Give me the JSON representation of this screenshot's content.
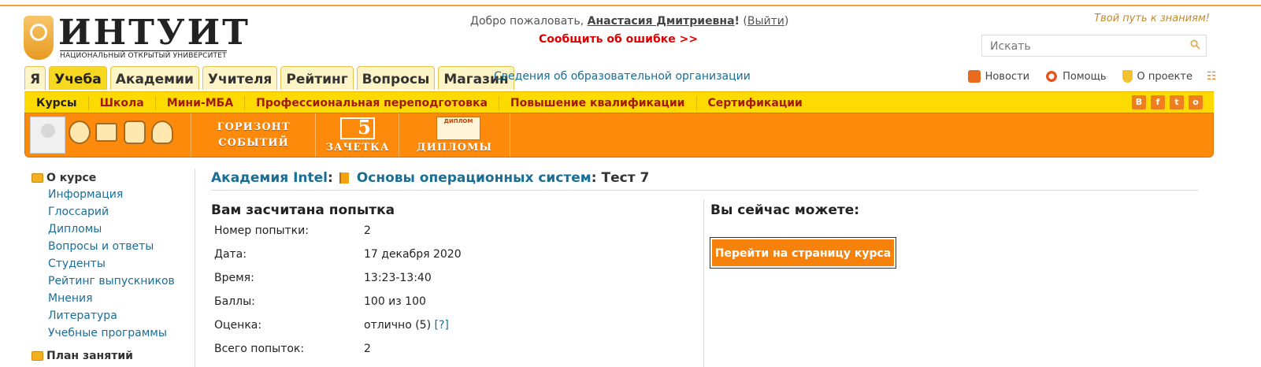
{
  "header": {
    "logo_text": "ИНТУИТ",
    "logo_sub": "НАЦИОНАЛЬНЫЙ ОТКРЫТЫЙ УНИВЕРСИТЕТ",
    "welcome_prefix": "Добро пожаловать,",
    "user_name": "Анастасия Дмитриевна",
    "user_suffix": "!",
    "exit_label": "Выйти",
    "report_error": "Сообщить об ошибке >>",
    "slogan": "Твой путь к знаниям!",
    "search_placeholder": "Искать"
  },
  "tabs": [
    "Я",
    "Учеба",
    "Академии",
    "Учителя",
    "Рейтинг",
    "Вопросы",
    "Магазин"
  ],
  "active_tab": "Учеба",
  "org_link": "Сведения об образовательной организации",
  "top_links": {
    "news": "Новости",
    "help": "Помощь",
    "about": "О проекте"
  },
  "submenu": [
    "Курсы",
    "Школа",
    "Мини-МБА",
    "Профессиональная переподготовка",
    "Повышение квалификации",
    "Сертификации"
  ],
  "social": [
    "В",
    "f",
    "t",
    "о"
  ],
  "orange_band": {
    "horizon_line1": "ГОРИЗОНТ",
    "horizon_line2": "СОБЫТИЙ",
    "zachetka": "ЗАЧЕТКА",
    "zachetka_num": "5",
    "diplomas": "ДИПЛОМЫ",
    "diploma_badge": "ДИПЛОМ"
  },
  "sidebar": {
    "section1": "О курсе",
    "items": [
      "Информация",
      "Глоссарий",
      "Дипломы",
      "Вопросы и ответы",
      "Студенты",
      "Рейтинг выпускников",
      "Мнения",
      "Литература",
      "Учебные программы"
    ],
    "section2": "План занятий"
  },
  "breadcrumb": {
    "academy": "Академия Intel",
    "course": "Основы операционных систем",
    "test": "Тест 7"
  },
  "result": {
    "title": "Вам засчитана попытка",
    "rows": [
      {
        "label": "Номер попытки:",
        "value": "2"
      },
      {
        "label": "Дата:",
        "value": "17 декабря 2020"
      },
      {
        "label": "Время:",
        "value": "13:23-13:40"
      },
      {
        "label": "Баллы:",
        "value": "100 из 100"
      },
      {
        "label": "Оценка:",
        "value": "отлично (5)",
        "hint": "[?]"
      },
      {
        "label": "Всего попыток:",
        "value": "2"
      }
    ]
  },
  "actions": {
    "title": "Вы сейчас можете:",
    "go_course": "Перейти на страницу курса"
  }
}
